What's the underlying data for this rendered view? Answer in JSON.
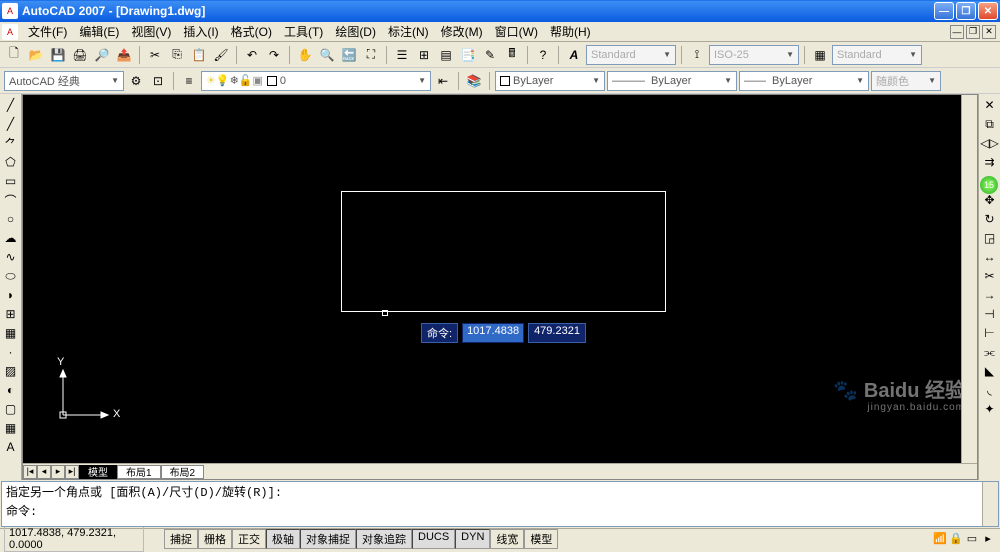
{
  "title": "AutoCAD 2007 - [Drawing1.dwg]",
  "menu": {
    "items": [
      "文件(F)",
      "编辑(E)",
      "视图(V)",
      "插入(I)",
      "格式(O)",
      "工具(T)",
      "绘图(D)",
      "标注(N)",
      "修改(M)",
      "窗口(W)",
      "帮助(H)"
    ]
  },
  "toolbar1": {
    "style_combo1": "Standard",
    "style_combo2": "ISO-25",
    "style_combo3": "Standard"
  },
  "toolbar2": {
    "workspace": "AutoCAD 经典",
    "layer": "0",
    "linetype1": "ByLayer",
    "linetype2": "ByLayer",
    "linetype3": "ByLayer",
    "color": "随颜色"
  },
  "tabs": {
    "nav": [
      "|◂",
      "◂",
      "▸",
      "▸|"
    ],
    "items": [
      "模型",
      "布局1",
      "布局2"
    ],
    "active": 0
  },
  "dynamic_input": {
    "label": "命令:",
    "val1": "1017.4838",
    "val2": "479.2321"
  },
  "command": {
    "line1": "指定另一个角点或 [面积(A)/尺寸(D)/旋转(R)]:",
    "line2": "命令:"
  },
  "status": {
    "coords": "1017.4838, 479.2321, 0.0000",
    "buttons": [
      "捕捉",
      "栅格",
      "正交",
      "极轴",
      "对象捕捉",
      "对象追踪",
      "DUCS",
      "DYN",
      "线宽",
      "模型"
    ],
    "pressed": [
      false,
      false,
      false,
      true,
      true,
      true,
      true,
      true,
      false,
      false
    ]
  },
  "ucs": {
    "x": "X",
    "y": "Y"
  },
  "watermark": {
    "main": "Baidu 经验",
    "sub": "jingyan.baidu.com"
  },
  "badge": "15",
  "icons": {
    "new": "🗋",
    "open": "📂",
    "save": "💾",
    "print": "🖨",
    "cut": "✂",
    "copy": "⎘",
    "paste": "📋",
    "undo": "↶",
    "redo": "↷",
    "pan": "✋",
    "zoom": "🔍",
    "line": "╱",
    "xline": "╱",
    "pline": "⺈",
    "polygon": "⬠",
    "rect": "▭",
    "arc": "⌒",
    "circle": "○",
    "revcloud": "☁",
    "spline": "∿",
    "ellipse": "⬭",
    "ellipsearc": "◗",
    "insert": "⊞",
    "block": "▦",
    "point": "·",
    "hatch": "▨",
    "grad": "◐",
    "region": "▢",
    "table": "▦",
    "mtext": "A",
    "erase": "✕",
    "copyobj": "⧉",
    "mirror": "◁▷",
    "offset": "⇉",
    "array": "⊞",
    "move": "✥",
    "rotate": "↻",
    "scale": "◲",
    "stretch": "↔",
    "trim": "✂",
    "extend": "→",
    "break1": "⊣",
    "break2": "⊢",
    "join": "⫘",
    "chamfer": "◣",
    "fillet": "◟",
    "explode": "✦"
  }
}
